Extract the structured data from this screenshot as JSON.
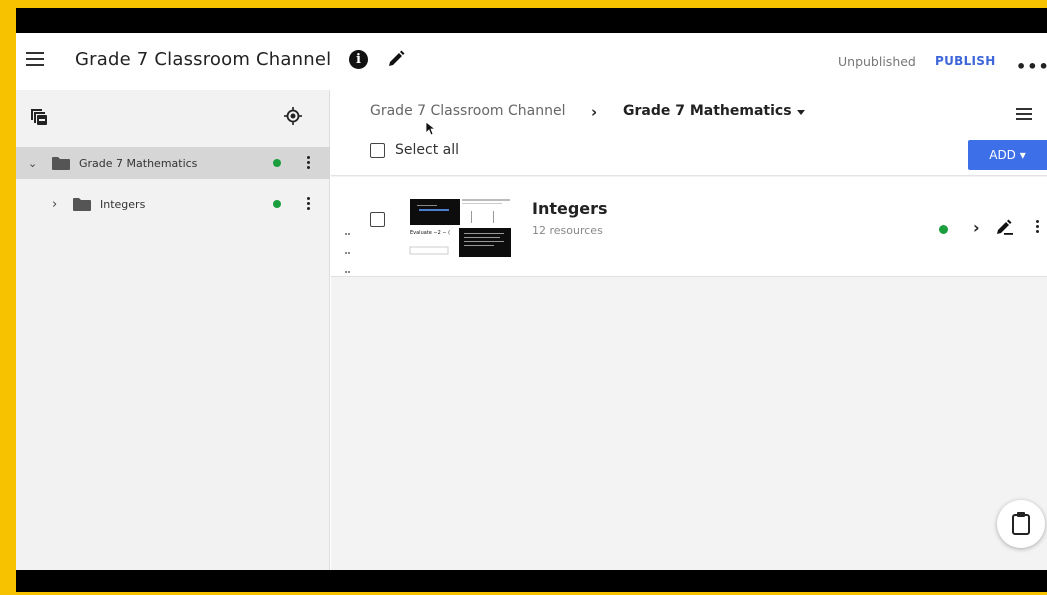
{
  "header": {
    "title": "Grade 7 Classroom Channel",
    "status": "Unpublished",
    "publish_label": "PUBLISH",
    "more_label": "•••"
  },
  "sidebar": {
    "items": [
      {
        "label": "Grade 7 Mathematics",
        "expanded": true,
        "selected": true,
        "status_color": "#1b9e3e"
      },
      {
        "label": "Integers",
        "expanded": false,
        "selected": false,
        "status_color": "#1b9e3e"
      }
    ]
  },
  "breadcrumb": {
    "root": "Grade 7 Classroom Channel",
    "separator": "›",
    "current": "Grade 7 Mathematics"
  },
  "toolbar": {
    "select_all_label": "Select all",
    "add_label": "ADD ▾"
  },
  "content": {
    "items": [
      {
        "title": "Integers",
        "subtitle": "12 resources",
        "status_color": "#1b9e3e",
        "thumb_text": "Evaluate −2 − ("
      }
    ]
  },
  "colors": {
    "accent": "#3d6fe8",
    "published_dot": "#1b9e3e",
    "frame": "#f7c300"
  }
}
